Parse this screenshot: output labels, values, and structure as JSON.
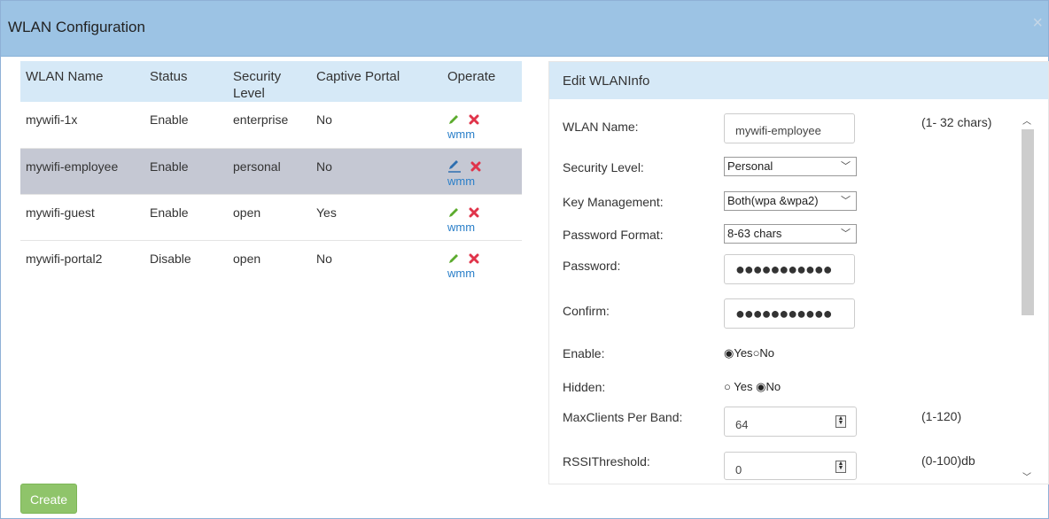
{
  "dialog": {
    "title": "WLAN Configuration",
    "close_glyph": "×"
  },
  "table": {
    "headers": [
      "WLAN Name",
      "Status",
      "Security Level",
      "Captive Portal",
      "Operate"
    ],
    "rows": [
      {
        "name": "mywifi-1x",
        "status": "Enable",
        "security": "enterprise",
        "portal": "No",
        "link": "wmm"
      },
      {
        "name": "mywifi-employee",
        "status": "Enable",
        "security": "personal",
        "portal": "No",
        "link": "wmm"
      },
      {
        "name": "mywifi-guest",
        "status": "Enable",
        "security": "open",
        "portal": "Yes",
        "link": "wmm"
      },
      {
        "name": "mywifi-portal2",
        "status": "Disable",
        "security": "open",
        "portal": "No",
        "link": "wmm"
      }
    ],
    "selected_row": 1
  },
  "create_label": "Create",
  "edit": {
    "title": "Edit WLANInfo",
    "labels": {
      "wlan_name": "WLAN Name:",
      "security_level": "Security Level:",
      "key_management": "Key Management:",
      "password_format": "Password Format:",
      "password": "Password:",
      "confirm": "Confirm:",
      "enable": "Enable:",
      "hidden": "Hidden:",
      "max_clients": "MaxClients Per Band:",
      "rssi": "RSSIThreshold:"
    },
    "values": {
      "wlan_name": "mywifi-employee",
      "security_level": "Personal",
      "key_management": "Both(wpa &wpa2)",
      "password_format": "8-63 chars",
      "password": "●●●●●●●●●●●",
      "confirm": "●●●●●●●●●●●",
      "enable_yes": "Yes",
      "enable_no": "No",
      "enable_selected": "Yes",
      "hidden_yes": "Yes",
      "hidden_no": "No",
      "hidden_selected": "No",
      "max_clients": "64",
      "rssi": "0"
    },
    "hints": {
      "wlan_name": "(1- 32 chars)",
      "max_clients": "(1-120)",
      "rssi": "(0-100)db"
    }
  },
  "colors": {
    "header_bg": "#9cc3e4",
    "table_head_bg": "#d6e9f7",
    "selected_row_bg": "#c5c8d3",
    "create_bg": "#8fc46a",
    "link": "#2a7fc9",
    "edit_icon": "#5cab2e",
    "delete_icon": "#e0344a"
  },
  "icons": {
    "edit": "pencil-icon",
    "delete": "delete-x-icon",
    "close": "close-icon"
  }
}
